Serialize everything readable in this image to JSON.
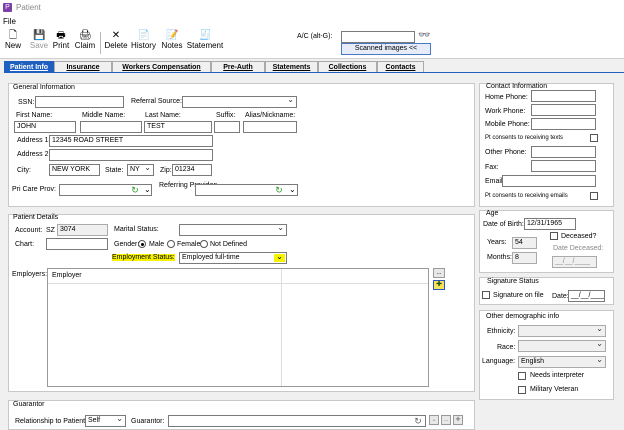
{
  "window": {
    "title": "Patient",
    "icon": "patient-app-icon"
  },
  "menu": {
    "file": "File"
  },
  "toolbar": {
    "new": "New",
    "save": "Save",
    "print": "Print",
    "claim": "Claim",
    "delete": "Delete",
    "history": "History",
    "notes": "Notes",
    "statement": "Statement",
    "ac_label": "A/C (alt-G):",
    "ac_value": "",
    "scanned_images": "Scanned images <<"
  },
  "tabs": [
    "Patient Info",
    "Insurance",
    "Workers Compensation",
    "Pre-Auth",
    "Statements",
    "Collections",
    "Contacts"
  ],
  "general": {
    "legend": "General Information",
    "ssn_label": "SSN:",
    "ssn": "",
    "referral_label": "Referral Source:",
    "referral": "",
    "first_label": "First Name:",
    "first": "JOHN",
    "middle_label": "Middle Name:",
    "middle": "",
    "last_label": "Last Name:",
    "last": "TEST",
    "suffix_label": "Suffix:",
    "suffix": "",
    "alias_label": "Alias/Nickname:",
    "alias": "",
    "addr1_label": "Address 1:",
    "addr1": "12345 ROAD STREET",
    "addr2_label": "Address 2:",
    "addr2": "",
    "city_label": "City:",
    "city": "NEW YORK",
    "state_label": "State:",
    "state": "NY",
    "zip_label": "Zip:",
    "zip": "01234",
    "pcp_label": "Pri Care Prov:",
    "pcp": "",
    "refprov_label": "Referring Provider:",
    "refprov": ""
  },
  "details": {
    "legend": "Patient Details",
    "account_label": "Account:",
    "account_prefix": "SZ",
    "account": "3074",
    "marital_label": "Marital Status:",
    "marital": "",
    "chart_label": "Chart:",
    "chart": "",
    "gender_label": "Gender:",
    "gender_options": [
      "Male",
      "Female",
      "Not Defined"
    ],
    "gender_selected": "Male",
    "employment_label": "Employment Status:",
    "employment": "Employed full-time",
    "employers_label": "Employers:",
    "employer_column": "Employer",
    "small_btn": "..."
  },
  "contact": {
    "legend": "Contact Information",
    "home_label": "Home Phone:",
    "home": "",
    "work_label": "Work Phone:",
    "work": "",
    "mobile_label": "Mobile Phone:",
    "mobile": "",
    "texts_consent": "Pt consents to receiving texts",
    "other_label": "Other Phone:",
    "other": "",
    "fax_label": "Fax:",
    "fax": "",
    "email_label": "Email:",
    "email": "",
    "emails_consent": "Pt consents to receiving emails"
  },
  "age": {
    "legend": "Age",
    "dob_label": "Date of Birth:",
    "dob": "12/31/1965",
    "deceased_label": "Deceased?",
    "years_label": "Years:",
    "years": "54",
    "date_deceased_label": "Date Deceased:",
    "date_deceased": "__/__/____",
    "months_label": "Months:",
    "months": "8"
  },
  "signature": {
    "legend": "Signature Status",
    "on_file_label": "Signature on file",
    "date_label": "Date:",
    "date": "__/__/____"
  },
  "demographic": {
    "legend": "Other demographic info",
    "ethnicity_label": "Ethnicity:",
    "ethnicity": "",
    "race_label": "Race:",
    "race": "",
    "language_label": "Language:",
    "language": "English",
    "interpreter_label": "Needs interpreter",
    "veteran_label": "Military Veteran"
  },
  "guarantor": {
    "legend": "Guarantor",
    "relationship_label": "Relationship to Patient:",
    "relationship": "Self",
    "guarantor_label": "Guarantor:",
    "guarantor": ""
  }
}
